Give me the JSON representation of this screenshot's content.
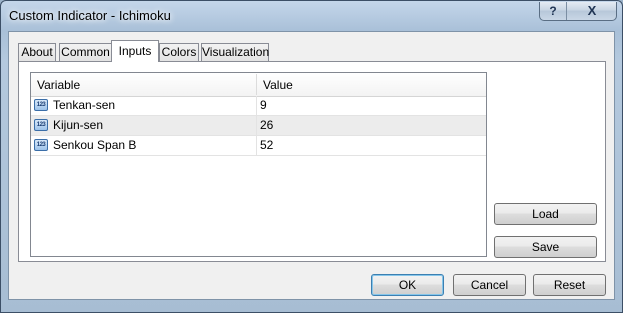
{
  "window": {
    "title": "Custom Indicator - Ichimoku",
    "help_glyph": "?",
    "close_glyph": "X"
  },
  "tabs": [
    {
      "label": "About",
      "active": false
    },
    {
      "label": "Common",
      "active": false
    },
    {
      "label": "Inputs",
      "active": true
    },
    {
      "label": "Colors",
      "active": false
    },
    {
      "label": "Visualization",
      "active": false
    }
  ],
  "grid": {
    "headers": {
      "variable": "Variable",
      "value": "Value"
    },
    "icon_text": "123",
    "rows": [
      {
        "variable": "Tenkan-sen",
        "value": "9"
      },
      {
        "variable": "Kijun-sen",
        "value": "26"
      },
      {
        "variable": "Senkou Span B",
        "value": "52"
      }
    ]
  },
  "side_buttons": {
    "load": "Load",
    "save": "Save"
  },
  "footer_buttons": {
    "ok": "OK",
    "cancel": "Cancel",
    "reset": "Reset"
  }
}
